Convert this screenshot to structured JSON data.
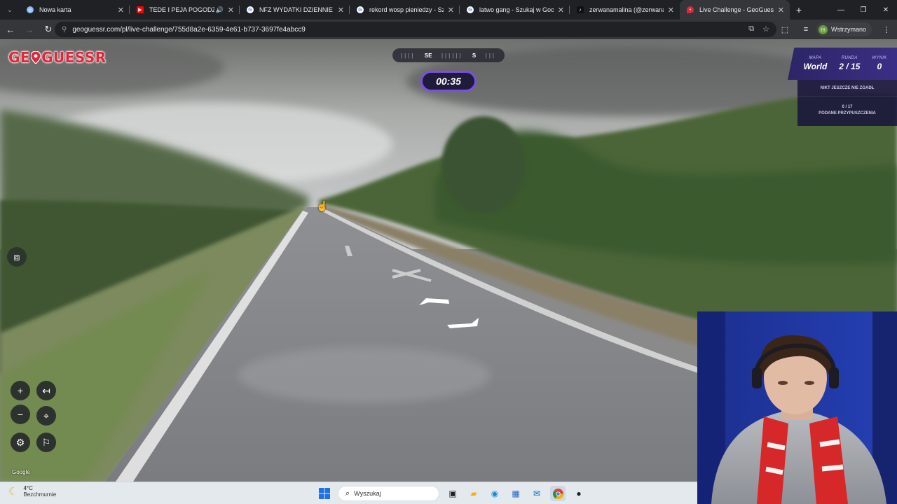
{
  "browser": {
    "tabs": [
      {
        "title": "Nowa karta",
        "favicon": "globe-icon",
        "active": false
      },
      {
        "title": "TEDE I PEJA POGODZENI? |",
        "favicon": "youtube-icon",
        "active": false,
        "audio": true
      },
      {
        "title": "NFZ WYDATKI DZIENNIE - Szuk",
        "favicon": "google-icon",
        "active": false
      },
      {
        "title": "rekord wosp pieniedzy - Szukaj",
        "favicon": "google-icon",
        "active": false
      },
      {
        "title": "latwo gang - Szukaj w Google",
        "favicon": "google-icon",
        "active": false
      },
      {
        "title": "zerwanamalina (@zerwanamali",
        "favicon": "tiktok-icon",
        "active": false
      },
      {
        "title": "Live Challenge - GeoGuessr",
        "favicon": "geoguessr-icon",
        "active": true
      }
    ],
    "url": "geoguessr.com/pl/live-challenge/755d8a2e-6359-4e61-b737-3697fe4abcc9",
    "profile_label": "Wstrzymano",
    "profile_initial": "m"
  },
  "game": {
    "logo_left": "GE",
    "logo_right": "GUESSR",
    "compass": {
      "left": "SE",
      "right": "S"
    },
    "timer": "00:35",
    "status": {
      "map_label": "MAPA",
      "map_value": "World",
      "round_label": "RUNDA",
      "round_value": "2 / 15",
      "score_label": "WYNIK",
      "score_value": "0",
      "nobody_guessed": "NIKT JESZCZE NIE ZGADŁ",
      "guesses_count": "0 / 17",
      "guesses_label": "PODANE PRZYPUSZCZENIA"
    },
    "attribution": "Google"
  },
  "taskbar": {
    "weather_temp": "4°C",
    "weather_desc": "Bezchmurnie",
    "search_placeholder": "Wyszukaj"
  }
}
